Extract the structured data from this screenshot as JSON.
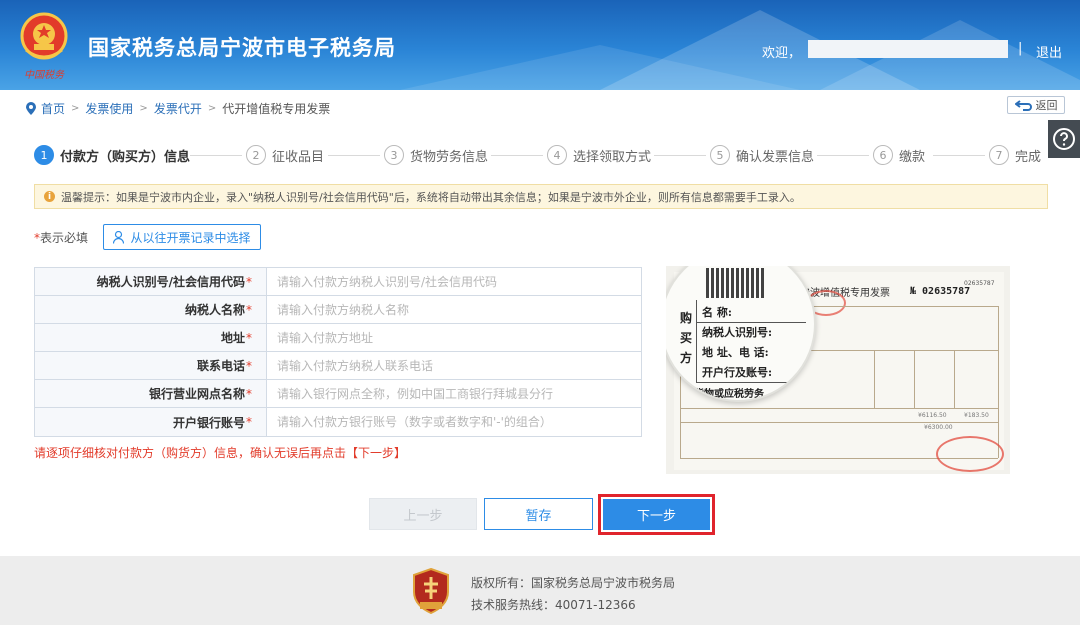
{
  "header": {
    "title": "国家税务总局宁波市电子税务局",
    "emblem_script": "中国税务",
    "welcome": "欢迎，",
    "separator": "|",
    "logout": "退出"
  },
  "breadcrumb": {
    "items": [
      "首页",
      "发票使用",
      "发票代开"
    ],
    "current": "代开增值税专用发票",
    "separator": ">"
  },
  "back_button": "返回",
  "help_icon": "question-circle-icon",
  "steps": [
    {
      "num": "1",
      "label": "付款方（购买方）信息",
      "active": true
    },
    {
      "num": "2",
      "label": "征收品目",
      "active": false
    },
    {
      "num": "3",
      "label": "货物劳务信息",
      "active": false
    },
    {
      "num": "4",
      "label": "选择领取方式",
      "active": false
    },
    {
      "num": "5",
      "label": "确认发票信息",
      "active": false
    },
    {
      "num": "6",
      "label": "缴款",
      "active": false
    },
    {
      "num": "7",
      "label": "完成",
      "active": false
    }
  ],
  "notice": {
    "text": "温馨提示：如果是宁波市内企业，录入\"纳税人识别号/社会信用代码\"后，系统将自动带出其余信息；如果是宁波市外企业，则所有信息都需要手工录入。"
  },
  "form": {
    "required_star": "*",
    "required_note": "表示必填",
    "history_button": "从以往开票记录中选择",
    "fields": [
      {
        "label": "纳税人识别号/社会信用代码",
        "placeholder": "请输入付款方纳税人识别号/社会信用代码",
        "value": ""
      },
      {
        "label": "纳税人名称",
        "placeholder": "请输入付款方纳税人名称",
        "value": ""
      },
      {
        "label": "地址",
        "placeholder": "请输入付款方地址",
        "value": ""
      },
      {
        "label": "联系电话",
        "placeholder": "请输入付款方纳税人联系电话",
        "value": ""
      },
      {
        "label": "银行营业网点名称",
        "placeholder": "请输入银行网点全称，例如中国工商银行拜城县分行",
        "value": ""
      },
      {
        "label": "开户银行账号",
        "placeholder": "请输入付款方银行账号（数字或者数字和'-'的组合）",
        "value": ""
      }
    ],
    "warning": "请逐项仔细核对付款方（购货方）信息，确认无误后再点击【下一步】"
  },
  "invoice_image": {
    "title": "宁波增值税专用发票",
    "number": "№ 02635787",
    "small_number": "02635787",
    "side_label": [
      "购",
      "买",
      "方"
    ],
    "fields": [
      "名        称:",
      "纳税人识别号:",
      "地 址、电 话:",
      "开户行及账号:"
    ],
    "goods_label": "货物或应税劳务",
    "amount1": "¥6116.50",
    "amount2": "¥183.50",
    "amount3": "¥6300.00"
  },
  "buttons": {
    "prev": "上一步",
    "save": "暂存",
    "next": "下一步"
  },
  "footer": {
    "copyright": "版权所有：国家税务总局宁波市税务局",
    "hotline": "技术服务热线：40071-12366"
  },
  "colors": {
    "header_blue": "#1a63b8",
    "accent_blue": "#2d8ce6",
    "required_red": "#e23b2a",
    "highlight_red": "#e0242c",
    "notice_bg": "#fdf6df"
  }
}
